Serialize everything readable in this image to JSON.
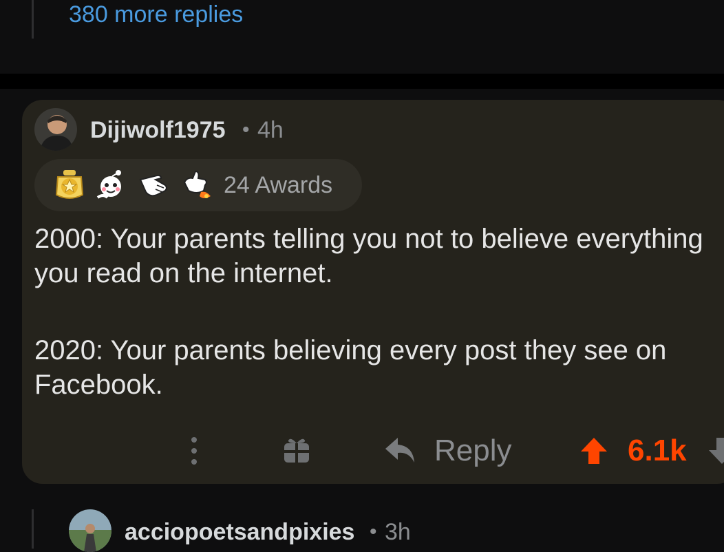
{
  "previous_thread": {
    "more_replies": "380 more replies"
  },
  "comment": {
    "username": "Dijiwolf1975",
    "separator": "•",
    "age": "4h",
    "awards": {
      "icons": [
        "ternion-award-icon",
        "wholesome-snoo-icon",
        "pointing-hand-icon",
        "rocket-like-icon"
      ],
      "count_label": "24 Awards"
    },
    "body": [
      "2000: Your parents telling you not to believe everything you read on the internet.",
      "2020: Your parents believing every post they see on Facebook."
    ],
    "actions": {
      "more_icon": "more-vertical-icon",
      "award_icon": "gift-icon",
      "reply_label": "Reply",
      "score": "6.1k"
    },
    "colors": {
      "upvote": "#ff4500",
      "link": "#4a9be0",
      "card_bg": "#25231c"
    }
  },
  "next_comment": {
    "username": "acciopoetsandpixies",
    "separator": "•",
    "age": "3h"
  }
}
